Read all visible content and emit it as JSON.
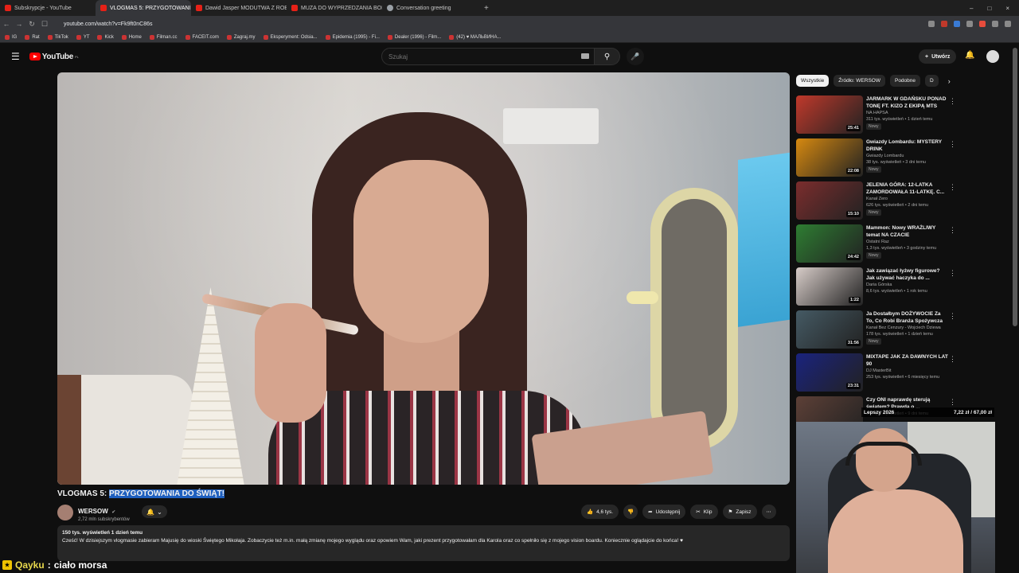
{
  "browser": {
    "tabs": [
      {
        "label": "Subskrypcje - YouTube",
        "active": false
      },
      {
        "label": "VLOGMAS 5: PRZYGOTOWANI",
        "active": true
      },
      {
        "label": "Dawid Jasper MODUTWA Z ROBALI",
        "active": false
      },
      {
        "label": "MUZA DO WYPRZEDZANIA BOEING",
        "active": false
      },
      {
        "label": "Conversation greeting",
        "active": false
      }
    ],
    "url": "youtube.com/watch?v=Fk9ft0nC86s",
    "bookmarks": [
      "IG",
      "Rat",
      "TikTok",
      "YT",
      "Kick",
      "Home",
      "Filman.cc",
      "FACEIT.com",
      "Zagraj.my",
      "Eksperyment: Odsia...",
      "Epidemia (1995) - Fi...",
      "Dealer (1996) - Film...",
      "(42) ♥ МАЛЬВИНА..."
    ]
  },
  "youtube": {
    "logo_text": "YouTube",
    "logo_region": "PL",
    "search_placeholder": "Szukaj",
    "create_label": "Utwórz"
  },
  "video": {
    "title_prefix": "VLOGMAS 5: ",
    "title_selected": "PRZYGOTOWANIA DO ŚWIĄT!",
    "channel": "WERSOW",
    "subscribers": "2,72 mln subskrybentów",
    "likes": "4,6 tys.",
    "share_label": "Udostępnij",
    "clip_label": "Klip",
    "save_label": "Zapisz",
    "views_date": "150 tys. wyświetleń  1 dzień temu",
    "description": "Cześć! W dzisiejszym vlogmasie zabieram Majusię do wioski Świętego Mikołaja. Zobaczycie też m.in. małą zmianę mojego wyglądu oraz opowiem Wam, jaki prezent przygotowałam dla Karola oraz co spełniło się z mojego vision boardu. Koniecznie oglądajcie do końca! ♥"
  },
  "chips": [
    "Wszystkie",
    "Źródło: WERSOW",
    "Podobne",
    "D"
  ],
  "related": [
    {
      "title": "JARMARK W GDAŃSKU PONAD TONĘ FT. KIZO Z EKIPĄ MTS",
      "channel": "NA HAPSA",
      "meta": "311 tys. wyświetleń • 1 dzień temu",
      "badge": "Nowy",
      "duration": "25:41",
      "color": "#c0392b"
    },
    {
      "title": "Gwiazdy Lombardu: MYSTERY DRINK",
      "channel": "Gwiazdy Lombardu",
      "meta": "38 tys. wyświetleń • 3 dni temu",
      "badge": "Nowy",
      "duration": "22:08",
      "color": "#d68910"
    },
    {
      "title": "JELENIA GÓRA: 12-LATKA ZAMORDOWAŁA 11-LATKĘ. C...",
      "channel": "Kanał Zero",
      "meta": "626 tys. wyświetleń • 2 dni temu",
      "badge": "Nowy",
      "duration": "15:10",
      "color": "#7b2d2d"
    },
    {
      "title": "Mammon: Nowy WRAŻLIWY temat NA CZACIE",
      "channel": "Ostatni Raz",
      "meta": "1,3 tys. wyświetleń • 3 godziny temu",
      "badge": "Nowy",
      "duration": "24:42",
      "color": "#2e7d32"
    },
    {
      "title": "Jak zawiązać łyżwy figurowe? Jak używać haczyka do ...",
      "channel": "Daria Górska",
      "meta": "8,6 tys. wyświetleń • 1 rok temu",
      "badge": "",
      "duration": "1:22",
      "color": "#d7ccc8"
    },
    {
      "title": "Ja Dostałbym DOŻYWOCIE Za To, Co Robi Branża Spożywcza",
      "channel": "Kanał Bez Cenzury - Wojciech Dziewa",
      "meta": "178 tys. wyświetleń • 1 dzień temu",
      "badge": "Nowy",
      "duration": "31:56",
      "color": "#455a64"
    },
    {
      "title": "MIXTAPE JAK ZA DAWNYCH LAT 90",
      "channel": "DJ MasterBit",
      "meta": "253 tys. wyświetleń • 6 miesięcy temu",
      "badge": "",
      "duration": "23:31",
      "color": "#1a237e"
    },
    {
      "title": "Czy ONI naprawdę sterują światem? Prawda o ...",
      "channel": "",
      "meta": "147 tys. wyświetleń • 9 dni temu",
      "badge": "",
      "duration": "",
      "color": "#5d4037"
    }
  ],
  "stream_overlay": {
    "left": "Lepszy 2026",
    "right": "7,22 zł / 67,00 zł"
  },
  "chat": {
    "user": "Qayku",
    "separator": " : ",
    "message": "ciało morsa"
  }
}
